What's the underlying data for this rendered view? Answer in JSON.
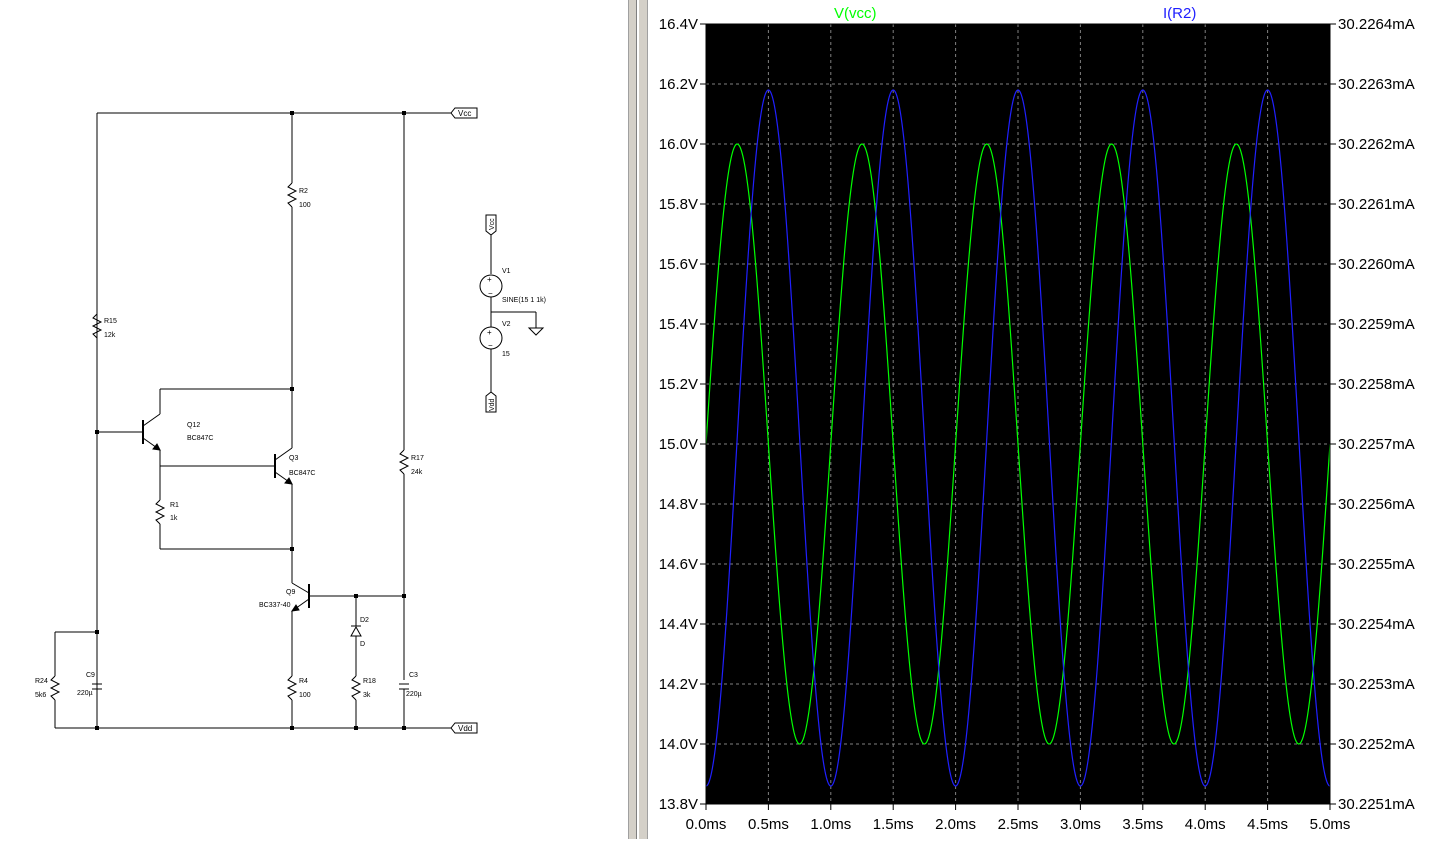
{
  "schematic": {
    "nets": {
      "vcc": "Vcc",
      "vdd": "Vdd"
    },
    "components": [
      {
        "ref": "R2",
        "value": "100"
      },
      {
        "ref": "R15",
        "value": "12k"
      },
      {
        "ref": "Q12",
        "value": "BC847C"
      },
      {
        "ref": "Q3",
        "value": "BC847C"
      },
      {
        "ref": "R1",
        "value": "1k"
      },
      {
        "ref": "R17",
        "value": "24k"
      },
      {
        "ref": "Q9",
        "value": "BC337-40"
      },
      {
        "ref": "D2",
        "value": "D"
      },
      {
        "ref": "R24",
        "value": "5k6"
      },
      {
        "ref": "C9",
        "value": "220µ"
      },
      {
        "ref": "R4",
        "value": "100"
      },
      {
        "ref": "R18",
        "value": "3k"
      },
      {
        "ref": "C3",
        "value": "220µ"
      },
      {
        "ref": "V1",
        "value": "SINE(15 1 1k)"
      },
      {
        "ref": "V2",
        "value": "15"
      }
    ]
  },
  "chart_data": {
    "type": "line",
    "background": "#000000",
    "grid": true,
    "grid_color": "#808080",
    "series": [
      {
        "name": "V(vcc)",
        "color": "#00ff00",
        "axis": "left",
        "function": "15 + 1*sin(2*pi*1000*t)",
        "offset": 15,
        "amplitude": 1,
        "frequency_hz": 1000,
        "phase_deg": 0
      },
      {
        "name": "I(R2)",
        "color": "#2020ff",
        "axis": "right",
        "offset_ma": 30.22571,
        "amplitude_ma": 0.00058,
        "frequency_hz": 1000,
        "phase_deg": -90
      }
    ],
    "x": {
      "range_ms": [
        0,
        5
      ],
      "ticks": [
        "0.0ms",
        "0.5ms",
        "1.0ms",
        "1.5ms",
        "2.0ms",
        "2.5ms",
        "3.0ms",
        "3.5ms",
        "4.0ms",
        "4.5ms",
        "5.0ms"
      ]
    },
    "y_left": {
      "range": [
        13.8,
        16.4
      ],
      "unit": "V",
      "ticks": [
        "16.4V",
        "16.2V",
        "16.0V",
        "15.8V",
        "15.6V",
        "15.4V",
        "15.2V",
        "15.0V",
        "14.8V",
        "14.6V",
        "14.4V",
        "14.2V",
        "14.0V",
        "13.8V"
      ]
    },
    "y_right": {
      "range": [
        30.2251,
        30.2264
      ],
      "unit": "mA",
      "ticks": [
        "30.2264mA",
        "30.2263mA",
        "30.2262mA",
        "30.2261mA",
        "30.2260mA",
        "30.2259mA",
        "30.2258mA",
        "30.2257mA",
        "30.2256mA",
        "30.2255mA",
        "30.2254mA",
        "30.2253mA",
        "30.2252mA",
        "30.2251mA"
      ]
    }
  }
}
